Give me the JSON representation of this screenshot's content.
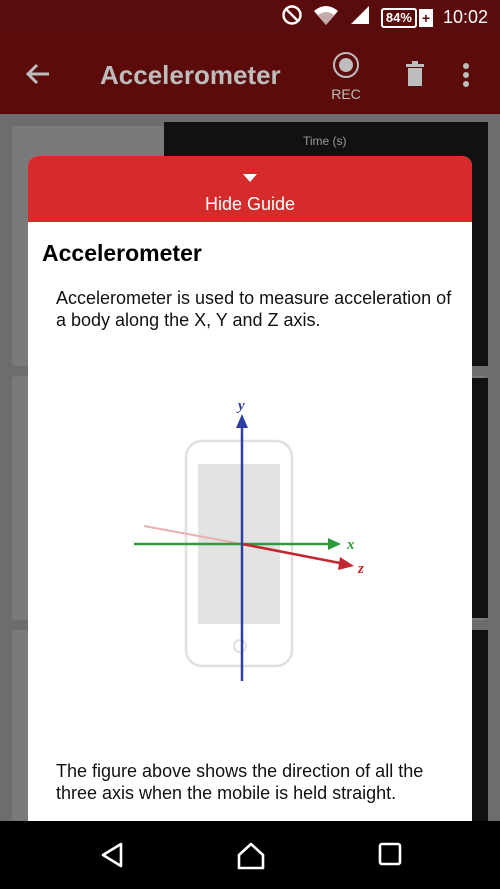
{
  "statusbar": {
    "battery_percent": "84%",
    "time": "10:02"
  },
  "appbar": {
    "title": "Accelerometer",
    "rec_label": "REC"
  },
  "background": {
    "time_axis_label": "Time (s)"
  },
  "guide": {
    "toggle_label": "Hide Guide",
    "title": "Accelerometer",
    "description": "Accelerometer is used to measure acceleration of a body along the X, Y and Z axis.",
    "figure": {
      "y_label": "y",
      "x_label": "x",
      "z_label": "z"
    },
    "caption": "The figure above shows the direction of all the three axis when the mobile is held straight."
  },
  "colors": {
    "accent": "#d62b2b",
    "appbar_dim": "#5c0b0b",
    "y_axis": "#2e3fa3",
    "x_axis": "#2e9a3c",
    "z_axis": "#c1272d"
  },
  "icons": [
    "dnd-icon",
    "wifi-icon",
    "signal-icon",
    "battery-icon",
    "back-arrow-icon",
    "rec-icon",
    "trash-icon",
    "more-vert-icon",
    "caret-down-icon",
    "nav-back-icon",
    "nav-home-icon",
    "nav-recents-icon"
  ]
}
